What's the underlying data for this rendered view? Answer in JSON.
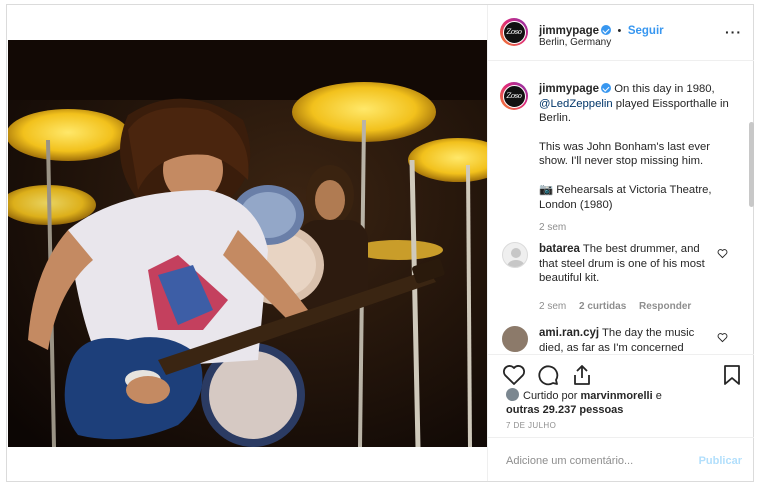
{
  "post": {
    "username": "jimmypage",
    "separator": "•",
    "follow_label": "Seguir",
    "location": "Berlin, Germany",
    "more_icon": "more-icon",
    "photo_description_icon": "concert-photo"
  },
  "caption": {
    "username": "jimmypage",
    "line1_pre": "On this day in 1980,",
    "mention": "@LedZeppelin",
    "line1_post": "played Eissporthalle in Berlin.",
    "para2": "This was John Bonham's last ever show. I'll never stop missing him.",
    "para3": "📷 Rehearsals at Victoria Theatre, London (1980)",
    "time": "2 sem"
  },
  "comments": [
    {
      "username": "batarea",
      "text": "The best drummer, and that steel drum is one of his most beautiful kit.",
      "time": "2 sem",
      "likes": "2 curtidas",
      "reply": "Responder"
    },
    {
      "username": "ami.ran.cyj",
      "text": "The day the music died, as far as I'm concerned"
    }
  ],
  "likes": {
    "prefix": "Curtido por",
    "user": "marvinmorelli",
    "conj": "e",
    "others": "outras 29.237 pessoas"
  },
  "date": "7 DE JULHO",
  "add_comment": {
    "placeholder": "Adicione um comentário...",
    "publish": "Publicar"
  },
  "colors": {
    "accent": "#3897f0",
    "publish_disabled": "#b2dffc",
    "text": "#262626",
    "muted": "#8e8e8e"
  }
}
